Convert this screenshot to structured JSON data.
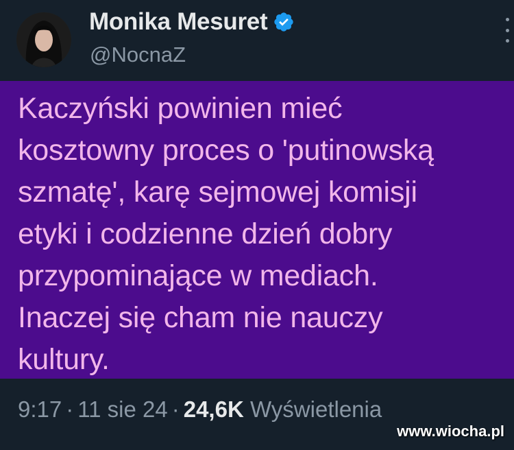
{
  "author": {
    "name": "Monika Mesuret",
    "handle": "@NocnaZ",
    "verified": true
  },
  "tweet": {
    "lines": [
      "Kaczyński powinien mieć",
      "kosztowny proces o 'putinowską",
      "szmatę', karę sejmowej komisji",
      "etyki i codzienne dzień dobry",
      "przypominające w mediach.",
      "Inaczej się cham nie nauczy",
      "kultury."
    ],
    "background_color": "#4c0c8d",
    "text_color": "#f2b6ea"
  },
  "meta": {
    "time": "9:17",
    "date": "11 sie 24",
    "views_count": "24,6K",
    "views_label": "Wyświetlenia",
    "separator": "·"
  },
  "watermark": "www.wiocha.pl",
  "icons": {
    "verified": "verified-badge-icon",
    "more": "more-options-icon"
  }
}
